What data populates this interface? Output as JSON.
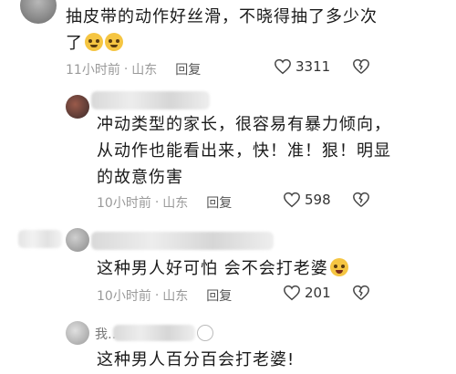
{
  "comments": [
    {
      "text_lines": [
        "抽皮带的动作好丝滑，不晓得抽了多少次",
        "了"
      ],
      "emojis": [
        "crying-face-emoji",
        "crying-face-emoji"
      ],
      "time": "11小时前",
      "location": "山东",
      "reply_label": "回复",
      "likes": "3311"
    },
    {
      "text_lines": [
        "冲动类型的家长，很容易有暴力倾向，",
        "从动作也能看出来，快！准！狠！明显",
        "的故意伤害"
      ],
      "time": "10小时前",
      "location": "山东",
      "reply_label": "回复",
      "likes": "598"
    },
    {
      "text_lines": [
        "这种男人好可怕 会不会打老婆"
      ],
      "emojis": [
        "rolling-laughing-emoji"
      ],
      "time": "10小时前",
      "location": "山东",
      "reply_label": "回复",
      "likes": "201"
    },
    {
      "text_lines": [
        "这种男人百分百会打老婆!"
      ],
      "partial_name": "我…"
    }
  ],
  "separator": "·"
}
